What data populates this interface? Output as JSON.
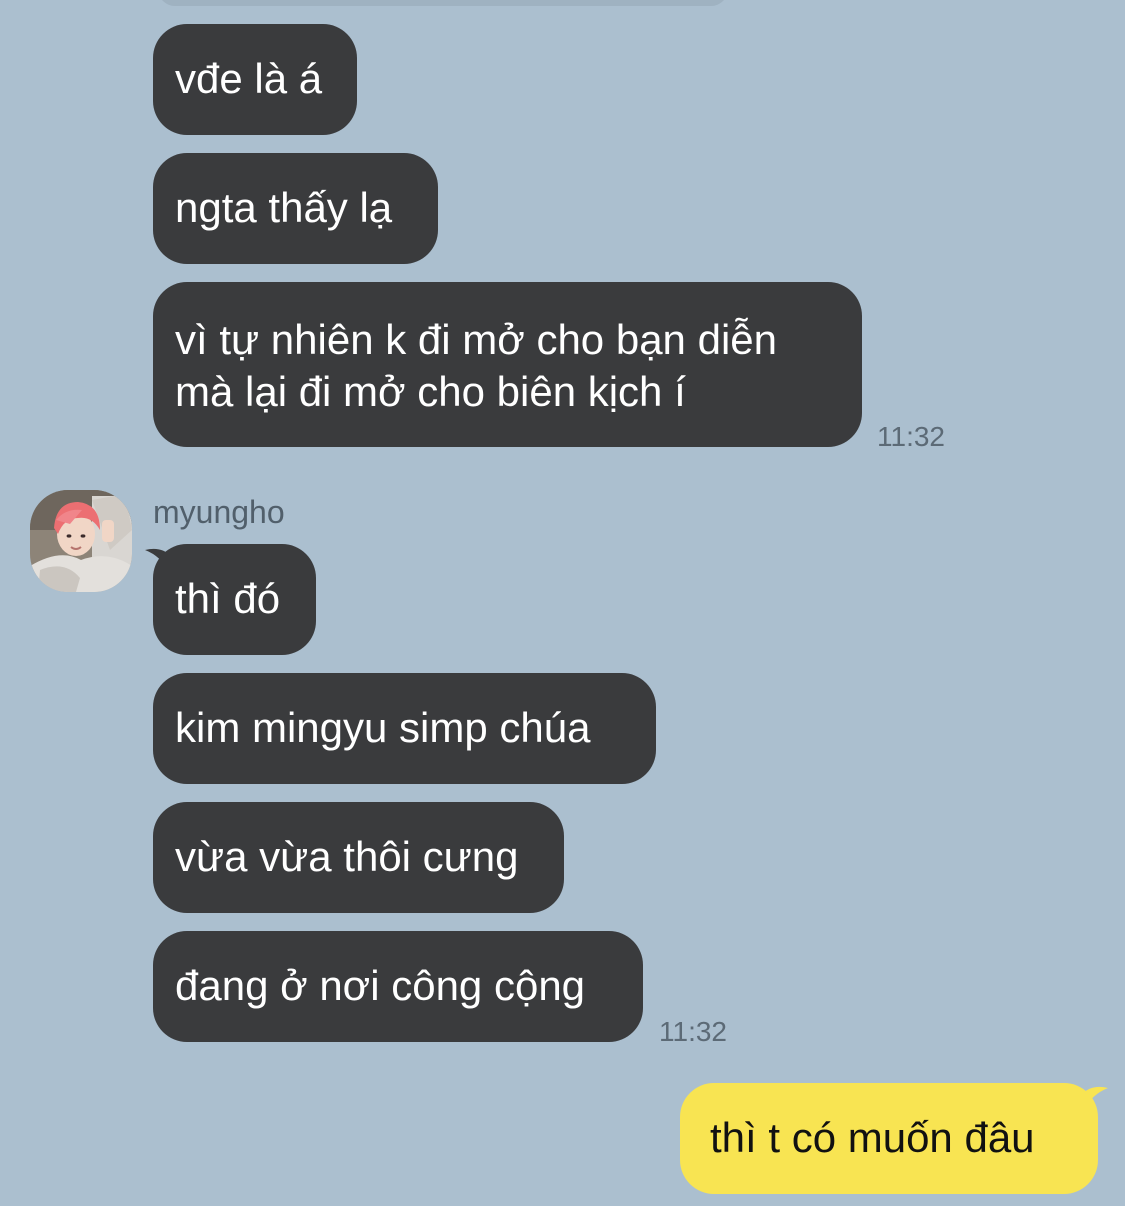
{
  "colors": {
    "background": "#abbfcf",
    "incoming_bubble": "#3a3b3d",
    "outgoing_bubble": "#f8e452",
    "timestamp_text": "#5c6a76"
  },
  "conversation": {
    "group1": {
      "messages": [
        "vđe là á",
        "ngta thấy lạ",
        {
          "line1": "vì tự nhiên k đi mở cho bạn diễn",
          "line2": "mà lại đi mở cho biên kịch í"
        }
      ],
      "time": "11:32"
    },
    "group2": {
      "sender": "myungho",
      "avatar_icon": "profile-photo",
      "messages": [
        "thì đó",
        "kim mingyu simp chúa",
        "vừa vừa thôi cưng",
        "đang ở nơi công cộng"
      ],
      "time": "11:32"
    },
    "outgoing": {
      "messages": [
        "thì t có muốn đâu"
      ]
    }
  }
}
